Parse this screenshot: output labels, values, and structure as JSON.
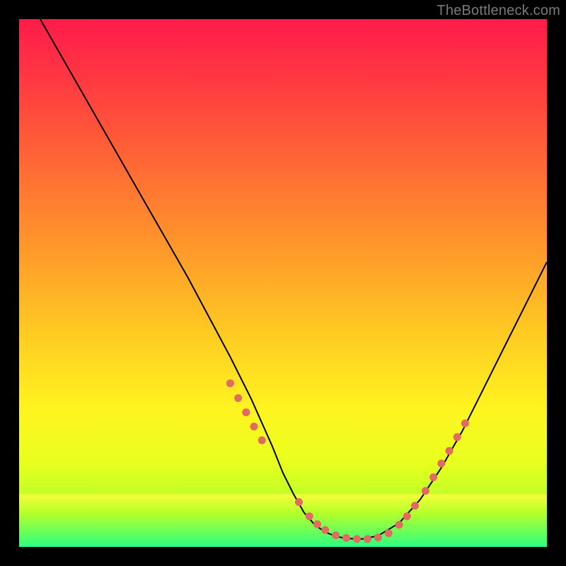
{
  "watermark": "TheBottleneck.com",
  "chart_data": {
    "type": "line",
    "title": "",
    "xlabel": "",
    "ylabel": "",
    "xlim": [
      0,
      100
    ],
    "ylim": [
      0,
      100
    ],
    "grid": false,
    "legend": false,
    "bottom_overlay": {
      "kind": "band",
      "color_top": "rgba(182,255,41,0.85)",
      "color_bottom": "#2dff80",
      "y_range": [
        0,
        10
      ]
    },
    "background_gradient": {
      "stops": [
        {
          "pos": 0.0,
          "color": "#ff1b4a"
        },
        {
          "pos": 0.12,
          "color": "#ff3a41"
        },
        {
          "pos": 0.28,
          "color": "#ff6a34"
        },
        {
          "pos": 0.44,
          "color": "#ff9a2a"
        },
        {
          "pos": 0.6,
          "color": "#ffcc22"
        },
        {
          "pos": 0.74,
          "color": "#fff41f"
        },
        {
          "pos": 0.84,
          "color": "#e8ff1e"
        },
        {
          "pos": 0.92,
          "color": "#b6ff29"
        },
        {
          "pos": 1.0,
          "color": "#2dff80"
        }
      ]
    },
    "series": [
      {
        "name": "curve",
        "color": "#000000",
        "stroke_width": 2,
        "x": [
          4,
          8,
          12,
          16,
          20,
          24,
          28,
          32,
          36,
          40,
          44,
          48,
          50,
          52,
          54,
          56,
          58,
          60,
          62,
          65,
          68,
          72,
          76,
          80,
          84,
          88,
          92,
          96,
          100
        ],
        "y": [
          100,
          93,
          86,
          79,
          72,
          65,
          58,
          51,
          43.5,
          36,
          28,
          19,
          14,
          10,
          6.5,
          4.2,
          2.8,
          2.0,
          1.6,
          1.5,
          2.1,
          4.5,
          9,
          15,
          22,
          30,
          38,
          46,
          54
        ]
      },
      {
        "name": "markers",
        "type": "scatter",
        "color": "#e26a63",
        "marker_radius": 5.5,
        "x": [
          40,
          41.5,
          43,
          44.5,
          46,
          53,
          55,
          56.5,
          58,
          60,
          62,
          64,
          66,
          68,
          70,
          72,
          73.5,
          75,
          77,
          78.5,
          80,
          81.5,
          83,
          84.5
        ],
        "y": [
          31,
          28.2,
          25.5,
          22.8,
          20.2,
          8.5,
          5.8,
          4.3,
          3.2,
          2.2,
          1.7,
          1.5,
          1.5,
          1.8,
          2.6,
          4.2,
          5.8,
          7.8,
          10.6,
          13.2,
          15.8,
          18.2,
          20.8,
          23.4
        ]
      }
    ]
  }
}
